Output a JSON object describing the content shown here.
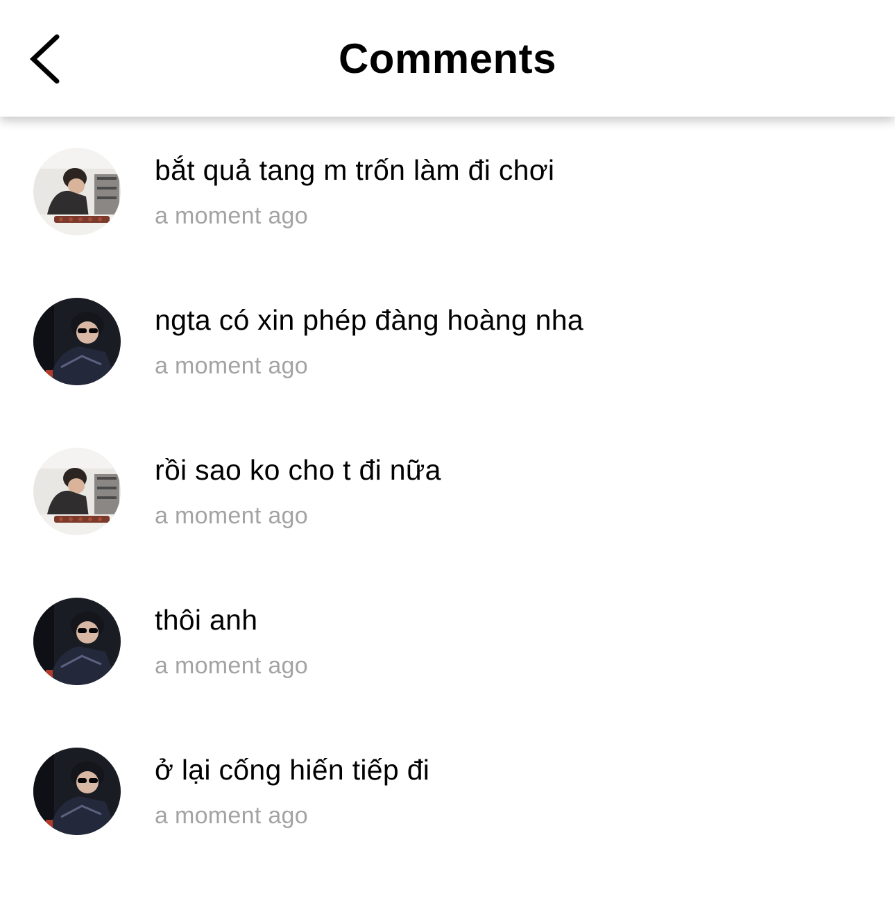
{
  "header": {
    "title": "Comments",
    "back_icon": "chevron-left-icon"
  },
  "colors": {
    "background": "#ffffff",
    "text": "#000000",
    "timestamp": "#a3a3a3"
  },
  "comments": [
    {
      "avatar": "avatar-chef",
      "text": "bắt quả tang m trốn làm đi chơi",
      "time": "a moment ago"
    },
    {
      "avatar": "avatar-sunglasses",
      "text": "ngta có xin phép đàng hoàng nha",
      "time": "a moment ago"
    },
    {
      "avatar": "avatar-chef",
      "text": "rồi sao ko cho t đi nữa",
      "time": "a moment ago"
    },
    {
      "avatar": "avatar-sunglasses",
      "text": "thôi anh",
      "time": "a moment ago"
    },
    {
      "avatar": "avatar-sunglasses",
      "text": "ở lại cống hiến tiếp đi",
      "time": "a moment ago"
    }
  ]
}
